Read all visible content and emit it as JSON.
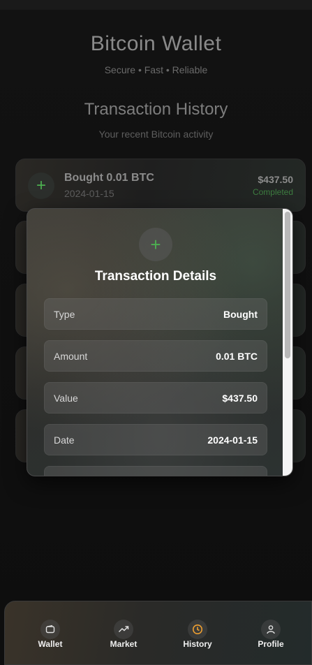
{
  "app": {
    "title": "Bitcoin Wallet",
    "tagline": "Secure • Fast • Reliable"
  },
  "history": {
    "title": "Transaction History",
    "subtitle": "Your recent Bitcoin activity"
  },
  "transactions": [
    {
      "name": "Bought 0.01 BTC",
      "date": "2024-01-15",
      "amount": "$437.50",
      "status": "Completed",
      "icon": "plus-icon"
    }
  ],
  "modal": {
    "title": "Transaction Details",
    "icon": "plus-icon",
    "rows": [
      {
        "label": "Type",
        "value": "Bought"
      },
      {
        "label": "Amount",
        "value": "0.01 BTC"
      },
      {
        "label": "Value",
        "value": "$437.50"
      },
      {
        "label": "Date",
        "value": "2024-01-15"
      }
    ]
  },
  "nav": {
    "items": [
      {
        "label": "Wallet",
        "icon": "wallet-icon",
        "active": false
      },
      {
        "label": "Market",
        "icon": "trending-up-icon",
        "active": false
      },
      {
        "label": "History",
        "icon": "clock-icon",
        "active": true
      },
      {
        "label": "Profile",
        "icon": "user-icon",
        "active": false
      }
    ]
  },
  "colors": {
    "accent_green": "#4caf50",
    "active_nav": "#f0a030",
    "background": "#0d0d0d"
  }
}
